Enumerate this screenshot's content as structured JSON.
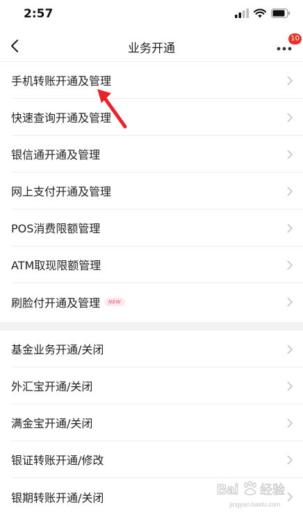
{
  "status_bar": {
    "time": "2:57"
  },
  "nav": {
    "title": "业务开通",
    "badge_count": "10"
  },
  "group1": [
    {
      "label": "手机转账开通及管理"
    },
    {
      "label": "快速查询开通及管理"
    },
    {
      "label": "银信通开通及管理"
    },
    {
      "label": "网上支付开通及管理"
    },
    {
      "label": "POS消费限额管理"
    },
    {
      "label": "ATM取现限额管理"
    },
    {
      "label": "刷脸付开通及管理",
      "tag": "NEW"
    }
  ],
  "group2": [
    {
      "label": "基金业务开通/关闭"
    },
    {
      "label": "外汇宝开通/关闭"
    },
    {
      "label": "满金宝开通/关闭"
    },
    {
      "label": "银证转账开通/修改"
    },
    {
      "label": "银期转账开通/关闭"
    }
  ],
  "colors": {
    "accent": "#e8332a",
    "chevron": "#c4c4c4"
  },
  "watermark": {
    "brand": "Baidu 经验",
    "url": "jingyan.baidu.com"
  }
}
